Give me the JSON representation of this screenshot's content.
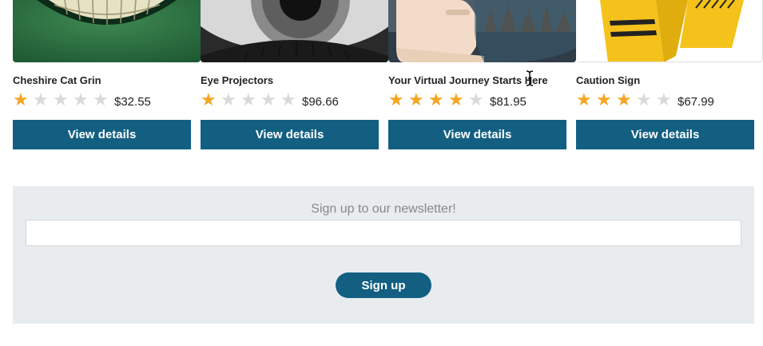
{
  "products": [
    {
      "title": "Cheshire Cat Grin",
      "rating": 1,
      "max_rating": 5,
      "price": "$32.55",
      "button_label": "View details",
      "image": "cheshire-cat-grin-image"
    },
    {
      "title": "Eye Projectors",
      "rating": 1,
      "max_rating": 5,
      "price": "$96.66",
      "button_label": "View details",
      "image": "eye-closeup-image"
    },
    {
      "title": "Your Virtual Journey Starts Here",
      "rating": 4,
      "max_rating": 5,
      "price": "$81.95",
      "button_label": "View details",
      "image": "smartphone-landscape-image"
    },
    {
      "title": "Caution Sign",
      "rating": 3,
      "max_rating": 5,
      "price": "$67.99",
      "button_label": "View details",
      "image": "caution-sign-image"
    }
  ],
  "newsletter": {
    "heading": "Sign up to our newsletter!",
    "input_value": "",
    "input_placeholder": "",
    "button_label": "Sign up"
  },
  "colors": {
    "button": "#135f82",
    "star_on": "#f5a623",
    "star_off": "#d9d9d9",
    "newsletter_bg": "#e8ecee"
  },
  "icons": {
    "rating": "star-icon",
    "pointer": "text-cursor-icon"
  }
}
